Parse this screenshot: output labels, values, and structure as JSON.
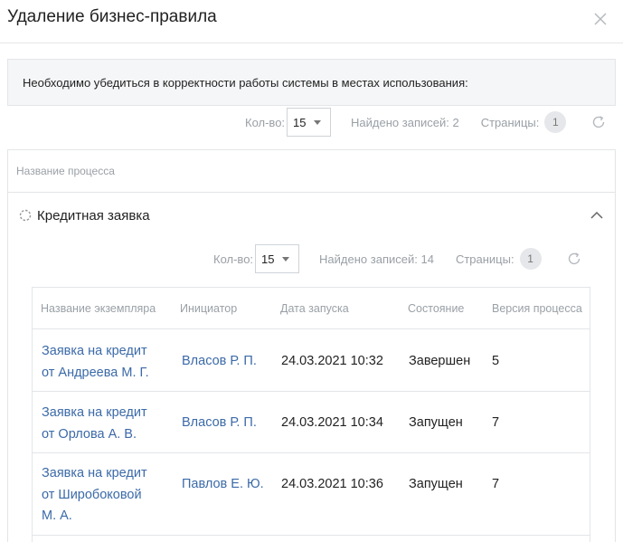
{
  "dialog": {
    "title": "Удаление бизнес-правила",
    "notice": "Необходимо убедиться в корректности работы системы в местах использования:"
  },
  "outer_pager": {
    "count_label": "Кол-во:",
    "count_value": "15",
    "found": "Найдено записей: 2",
    "pages_label": "Страницы:",
    "page": "1"
  },
  "outer_table": {
    "header": "Название процесса",
    "group": {
      "label": "Кредитная заявка"
    }
  },
  "inner_pager": {
    "count_label": "Кол-во:",
    "count_value": "15",
    "found": "Найдено записей: 14",
    "pages_label": "Страницы:",
    "page": "1"
  },
  "inner_table": {
    "columns": [
      "Название экземпляра",
      "Инициатор",
      "Дата запуска",
      "Состояние",
      "Версия процесса"
    ],
    "rows": [
      {
        "name_lines": [
          "Заявка на кредит",
          "от Андреева М. Г."
        ],
        "initiator": "Власов Р. П.",
        "date": "24.03.2021 10:32",
        "status": "Завершен",
        "version": "5"
      },
      {
        "name_lines": [
          "Заявка на кредит",
          "от Орлова А. В."
        ],
        "initiator": "Власов Р. П.",
        "date": "24.03.2021 10:34",
        "status": "Запущен",
        "version": "7"
      },
      {
        "name_lines": [
          "Заявка на кредит",
          "от Широбоковой",
          "М. А."
        ],
        "initiator": "Павлов Е. Ю.",
        "date": "24.03.2021 10:36",
        "status": "Запущен",
        "version": "7"
      }
    ]
  },
  "icons": {
    "close": "close-icon",
    "caret": "caret-down-icon",
    "refresh": "refresh-icon",
    "group": "process-icon",
    "collapse": "chevron-up-icon"
  }
}
